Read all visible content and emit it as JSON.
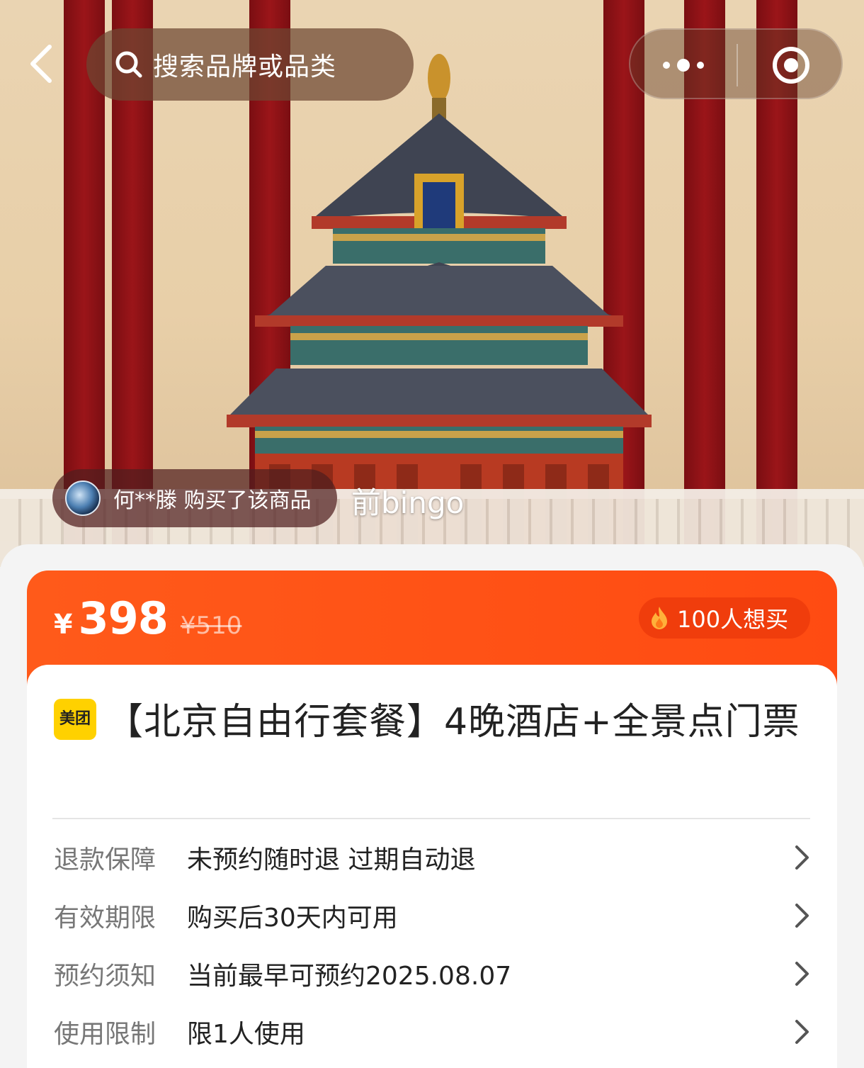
{
  "top_bar": {
    "search_placeholder": "搜索品牌或品类"
  },
  "hero": {
    "buyer_message": "何**滕 购买了该商品",
    "overlay_text": "前bingo"
  },
  "price": {
    "currency": "¥",
    "current": "398",
    "original": "¥510",
    "want_count_label": "100人想买"
  },
  "product": {
    "brand_badge": "美团",
    "title": "【北京自由行套餐】4晚酒店+全景点门票"
  },
  "info_rows": [
    {
      "label": "退款保障",
      "value": "未预约随时退 过期自动退"
    },
    {
      "label": "有效期限",
      "value": "购买后30天内可用"
    },
    {
      "label": "预约须知",
      "value": "当前最早可预约2025.08.07"
    },
    {
      "label": "使用限制",
      "value": "限1人使用"
    }
  ],
  "colors": {
    "accent_orange": "#ff5a1a",
    "brand_yellow": "#ffd100",
    "pillar_red": "#9b1519"
  }
}
